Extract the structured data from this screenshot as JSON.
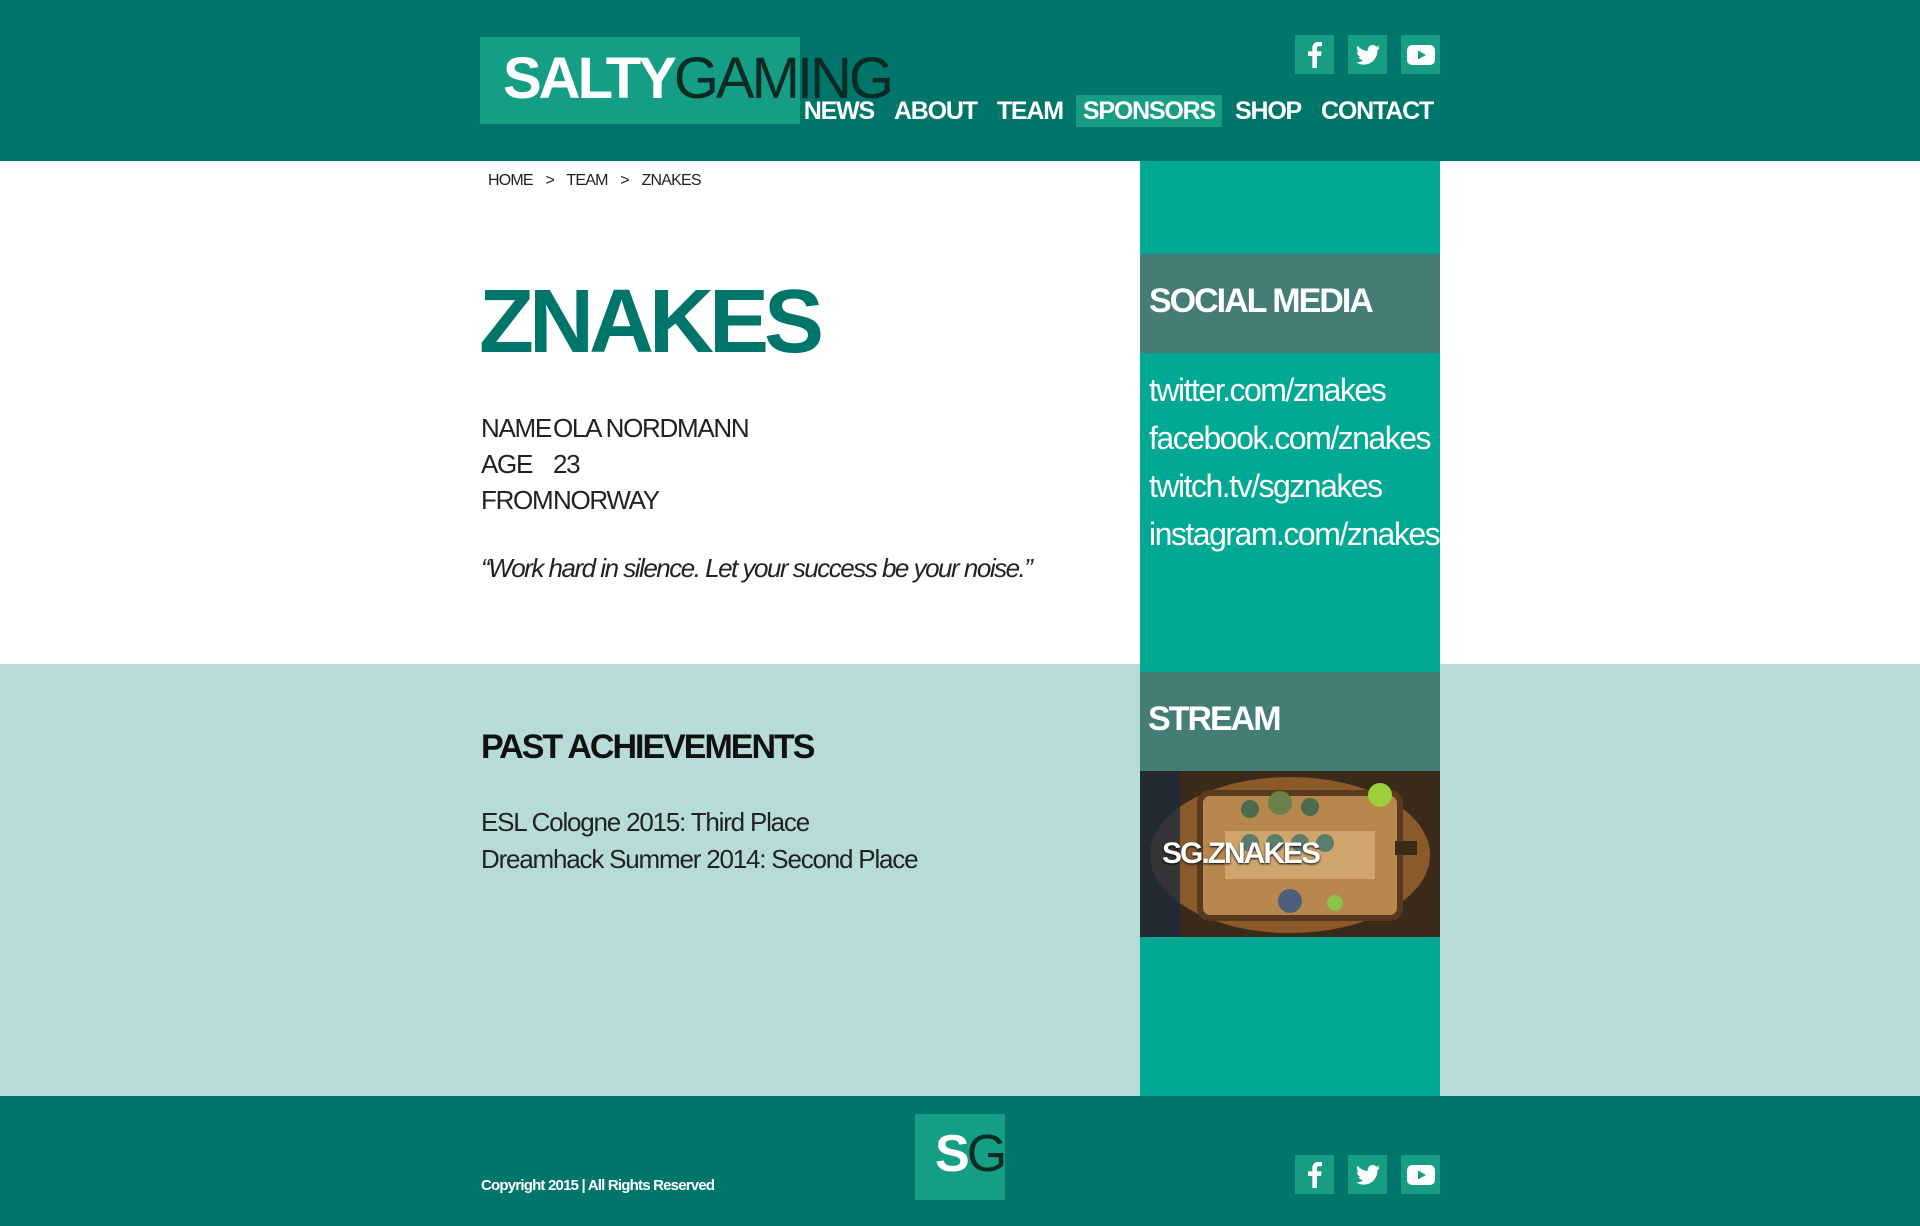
{
  "header": {
    "logo": {
      "part1": "SALTY",
      "part2": "GAMING"
    },
    "social_icons": [
      "facebook-icon",
      "twitter-icon",
      "youtube-icon"
    ],
    "nav": [
      {
        "label": "NEWS",
        "active": false
      },
      {
        "label": "ABOUT",
        "active": false
      },
      {
        "label": "TEAM",
        "active": false
      },
      {
        "label": "SPONSORS",
        "active": true
      },
      {
        "label": "SHOP",
        "active": false
      },
      {
        "label": "CONTACT",
        "active": false
      }
    ]
  },
  "breadcrumb": [
    "HOME",
    ">",
    "TEAM",
    ">",
    "ZNAKES"
  ],
  "player": {
    "title": "ZNAKES",
    "info": [
      {
        "label": "NAME",
        "value": "OLA NORDMANN"
      },
      {
        "label": "AGE",
        "value": "23"
      },
      {
        "label": "FROM",
        "value": "NORWAY"
      }
    ],
    "quote": "“Work hard in silence. Let your success be your noise.”"
  },
  "achievements": {
    "title": "PAST ACHIEVEMENTS",
    "items": [
      "ESL Cologne 2015: Third Place",
      "Dreamhack Summer 2014: Second Place"
    ]
  },
  "sidebar": {
    "social_title": "SOCIAL MEDIA",
    "social_links": [
      "twitter.com/znakes",
      "facebook.com/znakes",
      "twitch.tv/sgznakes",
      "instagram.com/znakes"
    ],
    "stream_title": "STREAM",
    "stream_label": "SG.ZNAKES"
  },
  "footer": {
    "copyright": "Copyright 2015 | All Rights Reserved",
    "logo": {
      "part1": "S",
      "part2": "G"
    }
  },
  "colors": {
    "header_bg": "#00766b",
    "accent": "#149f85",
    "sidebar_bg": "#01a995",
    "sidebar_head": "#447d76",
    "band_bg": "#b6dbd8"
  }
}
